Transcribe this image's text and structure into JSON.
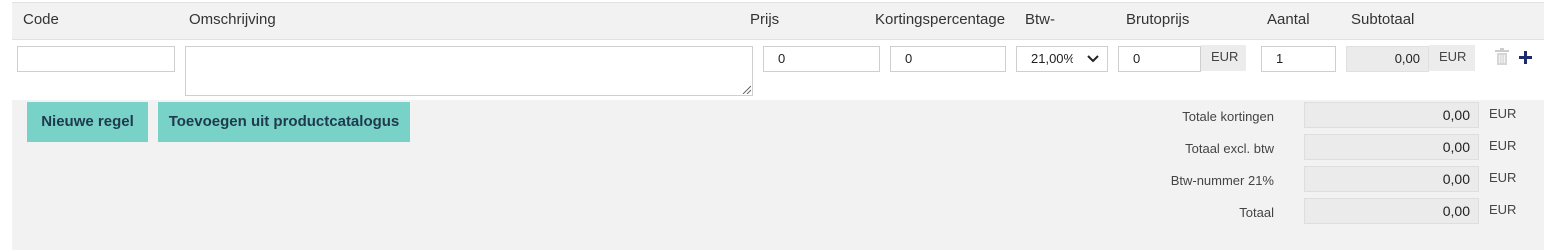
{
  "columns": {
    "code": "Code",
    "description": "Omschrijving",
    "price": "Prijs",
    "discount": "Kortingspercentage",
    "vat": "Btw-",
    "gross": "Brutoprijs",
    "quantity": "Aantal",
    "subtotal": "Subtotaal"
  },
  "line": {
    "code": "",
    "description": "",
    "price": "0",
    "discount": "0",
    "vat_selected": "21,00%",
    "gross": "0",
    "gross_unit": "EUR",
    "quantity": "1",
    "subtotal": "0,00",
    "subtotal_unit": "EUR"
  },
  "buttons": {
    "new_line": "Nieuwe regel",
    "add_from_catalog": "Toevoegen uit productcatalogus"
  },
  "totals": [
    {
      "label": "Totale kortingen",
      "value": "0,00",
      "unit": "EUR"
    },
    {
      "label": "Totaal excl. btw",
      "value": "0,00",
      "unit": "EUR"
    },
    {
      "label": "Btw-nummer 21%",
      "value": "0,00",
      "unit": "EUR"
    },
    {
      "label": "Totaal",
      "value": "0,00",
      "unit": "EUR"
    }
  ],
  "icons": {
    "delete": "trash-icon",
    "add": "plus-icon"
  },
  "colors": {
    "button_bg": "#79d2c8",
    "button_text": "#1f3a4c",
    "plus": "#1f2a6b"
  }
}
